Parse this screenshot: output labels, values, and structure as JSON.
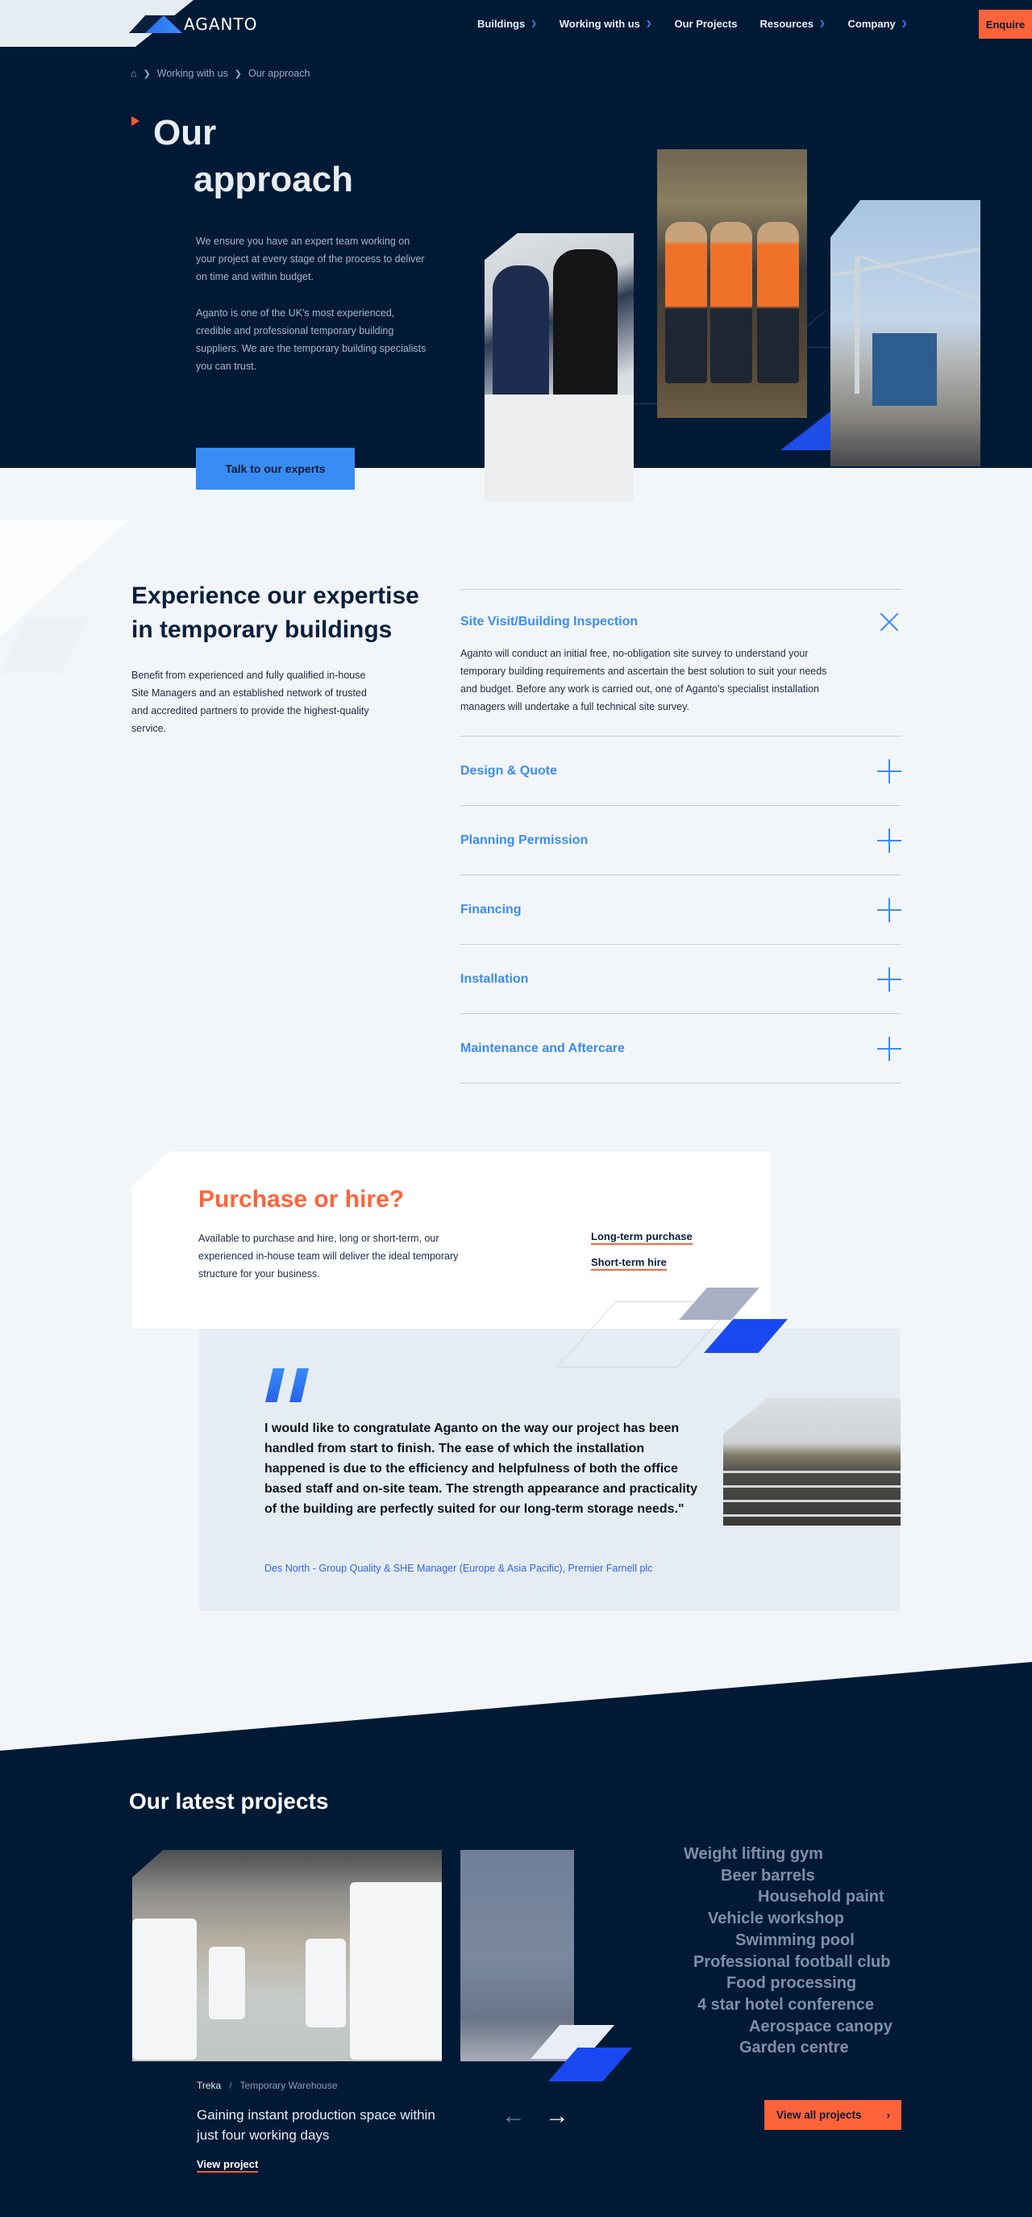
{
  "header": {
    "logo_text": "AGANTO",
    "nav": [
      {
        "label": "Buildings",
        "has_dropdown": true
      },
      {
        "label": "Working with us",
        "has_dropdown": true
      },
      {
        "label": "Our Projects",
        "has_dropdown": false
      },
      {
        "label": "Resources",
        "has_dropdown": true
      },
      {
        "label": "Company",
        "has_dropdown": true
      }
    ],
    "enquire_label": "Enquire"
  },
  "breadcrumb": {
    "home_icon": "home-icon",
    "items": [
      "Working with us",
      "Our approach"
    ]
  },
  "hero": {
    "title_line1": "Our",
    "title_line2": "approach",
    "paragraph1": "We ensure you have an expert team working on your project at every stage of the process to deliver on time and within budget.",
    "paragraph2": "Aganto is one of the UK's most experienced, credible and professional temporary building suppliers. We are the temporary building specialists you can trust.",
    "cta_label": "Talk to our experts"
  },
  "expertise": {
    "title": "Experience our expertise in temporary buildings",
    "paragraph": "Benefit from experienced and fully qualified in-house Site Managers and an established network of trusted and accredited partners to provide the highest-quality service.",
    "accordion": [
      {
        "title": "Site Visit/Building Inspection",
        "expanded": true,
        "body": "Aganto will conduct an initial free, no-obligation site survey to understand your temporary building requirements and ascertain the best solution to suit your needs and budget. Before any work is carried out, one of Aganto's specialist installation managers will undertake a full technical site survey."
      },
      {
        "title": "Design & Quote",
        "expanded": false
      },
      {
        "title": "Planning Permission",
        "expanded": false
      },
      {
        "title": "Financing",
        "expanded": false
      },
      {
        "title": "Installation",
        "expanded": false
      },
      {
        "title": "Maintenance and Aftercare",
        "expanded": false
      }
    ]
  },
  "purchase": {
    "title": "Purchase or hire?",
    "paragraph": "Available to purchase and hire, long or short-term, our experienced in-house team will deliver the ideal temporary structure for your business.",
    "links": [
      "Long-term purchase",
      "Short-term hire"
    ]
  },
  "testimonial": {
    "quote": "I would like to congratulate Aganto on the way our project has been handled from start to finish. The ease of which the installation happened is due to the efficiency and helpfulness of both the office based staff and on-site team. The strength appearance and practicality of the building are perfectly suited for our long-term storage needs.\"",
    "author": "Des North - Group Quality & SHE Manager (Europe & Asia Pacific), Premier Farnell plc"
  },
  "projects": {
    "title": "Our latest projects",
    "current": {
      "client": "Treka",
      "type": "Temporary Warehouse",
      "headline": "Gaining instant production space within just four working days",
      "link_label": "View project"
    },
    "prev_label": "←",
    "next_label": "→",
    "tags": [
      "Weight lifting gym",
      "Beer barrels",
      "Household paint",
      "Vehicle workshop",
      "Swimming pool",
      "Professional football club",
      "Food processing",
      "4 star hotel conference",
      "Aerospace canopy",
      "Garden centre"
    ],
    "view_all_label": "View all projects",
    "view_all_chevron": "›"
  },
  "colors": {
    "navy": "#001a36",
    "accent_orange": "#ff633a",
    "accent_blue": "#3a8cf5",
    "deep_blue": "#1a48f0",
    "page_bg": "#f3f6f8"
  }
}
